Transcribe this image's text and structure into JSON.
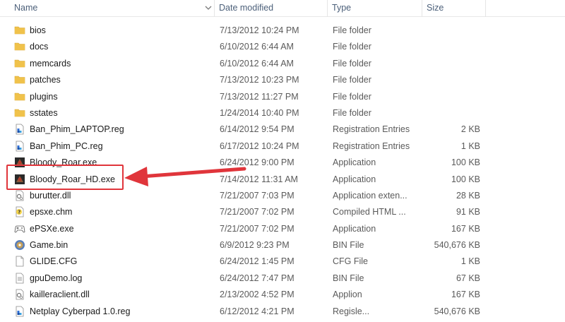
{
  "columns": {
    "name": "Name",
    "date": "Date modified",
    "type": "Type",
    "size": "Size"
  },
  "files": [
    {
      "name": "bios",
      "date": "7/13/2012 10:24 PM",
      "type": "File folder",
      "size": "",
      "icon": "folder-icon"
    },
    {
      "name": "docs",
      "date": "6/10/2012 6:44 AM",
      "type": "File folder",
      "size": "",
      "icon": "folder-icon"
    },
    {
      "name": "memcards",
      "date": "6/10/2012 6:44 AM",
      "type": "File folder",
      "size": "",
      "icon": "folder-icon"
    },
    {
      "name": "patches",
      "date": "7/13/2012 10:23 PM",
      "type": "File folder",
      "size": "",
      "icon": "folder-icon"
    },
    {
      "name": "plugins",
      "date": "7/13/2012 11:27 PM",
      "type": "File folder",
      "size": "",
      "icon": "folder-icon"
    },
    {
      "name": "sstates",
      "date": "1/24/2014 10:40 PM",
      "type": "File folder",
      "size": "",
      "icon": "folder-icon"
    },
    {
      "name": "Ban_Phim_LAPTOP.reg",
      "date": "6/14/2012 9:54 PM",
      "type": "Registration Entries",
      "size": "2 KB",
      "icon": "registry-file-icon"
    },
    {
      "name": "Ban_Phim_PC.reg",
      "date": "6/17/2012 10:24 PM",
      "type": "Registration Entries",
      "size": "1 KB",
      "icon": "registry-file-icon"
    },
    {
      "name": "Bloody_Roar.exe",
      "date": "6/24/2012 9:00 PM",
      "type": "Application",
      "size": "100 KB",
      "icon": "game-app-icon"
    },
    {
      "name": "Bloody_Roar_HD.exe",
      "date": "7/14/2012 11:31 AM",
      "type": "Application",
      "size": "100 KB",
      "icon": "game-app-icon"
    },
    {
      "name": "burutter.dll",
      "date": "7/21/2007 7:03 PM",
      "type": "Application exten...",
      "size": "28 KB",
      "icon": "dll-file-icon"
    },
    {
      "name": "epsxe.chm",
      "date": "7/21/2007 7:02 PM",
      "type": "Compiled HTML ...",
      "size": "91 KB",
      "icon": "help-file-icon"
    },
    {
      "name": "ePSXe.exe",
      "date": "7/21/2007 7:02 PM",
      "type": "Application",
      "size": "167 KB",
      "icon": "gamepad-app-icon"
    },
    {
      "name": "Game.bin",
      "date": "6/9/2012 9:23 PM",
      "type": "BIN File",
      "size": "540,676 KB",
      "icon": "disc-image-icon"
    },
    {
      "name": "GLIDE.CFG",
      "date": "6/24/2012 1:45 PM",
      "type": "CFG File",
      "size": "1 KB",
      "icon": "blank-file-icon"
    },
    {
      "name": "gpuDemo.log",
      "date": "6/24/2012 7:47 PM",
      "type": "BIN File",
      "size": "67 KB",
      "icon": "text-file-icon"
    },
    {
      "name": "kailleraclient.dll",
      "date": "2/13/2002 4:52 PM",
      "type": "Applion",
      "size": "167 KB",
      "icon": "dll-file-icon"
    },
    {
      "name": "Netplay Cyberpad 1.0.reg",
      "date": "6/12/2012 4:21 PM",
      "type": "Regisle...",
      "size": "540,676 KB",
      "icon": "registry-file-icon"
    }
  ],
  "annotation": {
    "highlight_color": "#e0353b",
    "target_file": "Bloody_Roar_HD.exe"
  },
  "colors": {
    "folder": "#f0c24b",
    "header_text": "#4c607a"
  }
}
